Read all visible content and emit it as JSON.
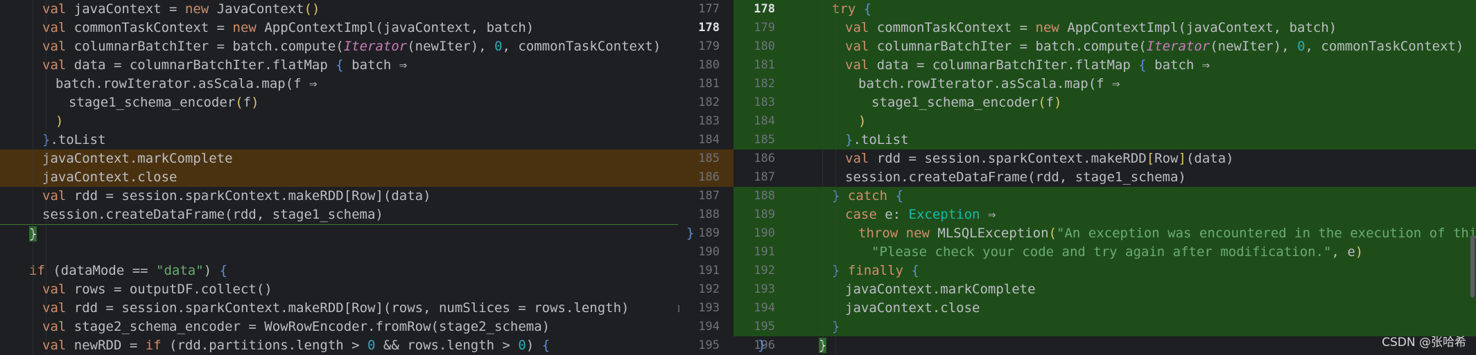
{
  "left": {
    "lines": [
      {
        "indent": 3,
        "tokens": [
          [
            "kw",
            "val"
          ],
          [
            "",
            " javaContext = "
          ],
          [
            "kw",
            "new"
          ],
          [
            "",
            " JavaContext"
          ],
          [
            "br",
            "()"
          ]
        ],
        "bg": ""
      },
      {
        "indent": 3,
        "tokens": [
          [
            "kw",
            "val"
          ],
          [
            "",
            " commonTaskContext = "
          ],
          [
            "kw",
            "new"
          ],
          [
            "",
            " AppContextImpl(javaContext, batch)"
          ]
        ],
        "bg": ""
      },
      {
        "indent": 3,
        "tokens": [
          [
            "kw",
            "val"
          ],
          [
            "",
            " columnarBatchIter = batch.compute("
          ],
          [
            "it",
            "Iterator"
          ],
          [
            "",
            "(newIter), "
          ],
          [
            "numlit",
            "0"
          ],
          [
            "",
            ", commonTaskContext)"
          ]
        ],
        "bg": ""
      },
      {
        "indent": 3,
        "tokens": [
          [
            "kw",
            "val"
          ],
          [
            "",
            " data = columnarBatchIter.flatMap "
          ],
          [
            "brb",
            "{"
          ],
          [
            "",
            " batch ⇒"
          ]
        ],
        "bg": ""
      },
      {
        "indent": 4,
        "tokens": [
          [
            "",
            "batch.rowIterator.asScala.map(f ⇒"
          ]
        ],
        "bg": ""
      },
      {
        "indent": 5,
        "tokens": [
          [
            "",
            "stage1_schema_encoder"
          ],
          [
            "br",
            "("
          ],
          [
            "",
            "f"
          ],
          [
            "br",
            ")"
          ]
        ],
        "bg": ""
      },
      {
        "indent": 4,
        "tokens": [
          [
            "br",
            ")"
          ]
        ],
        "bg": ""
      },
      {
        "indent": 3,
        "tokens": [
          [
            "brb",
            "}"
          ],
          [
            "",
            ".toList"
          ]
        ],
        "bg": ""
      },
      {
        "indent": 3,
        "tokens": [
          [
            "",
            "javaContext.markComplete"
          ]
        ],
        "bg": "mod"
      },
      {
        "indent": 3,
        "tokens": [
          [
            "",
            "javaContext.close"
          ]
        ],
        "bg": "mod"
      },
      {
        "indent": 3,
        "tokens": [
          [
            "kw",
            "val"
          ],
          [
            "",
            " rdd = session.sparkContext.makeRDD[Row](data)"
          ]
        ],
        "bg": ""
      },
      {
        "indent": 3,
        "tokens": [
          [
            "",
            "session.createDataFrame(rdd, stage1_schema)"
          ]
        ],
        "bg": ""
      },
      {
        "indent": 2,
        "tokens": [
          [
            "fold",
            "}"
          ]
        ],
        "bg": "delmark"
      },
      {
        "indent": 0,
        "tokens": [],
        "bg": ""
      },
      {
        "indent": 2,
        "tokens": [
          [
            "kw",
            "if"
          ],
          [
            "",
            " (dataMode == "
          ],
          [
            "str",
            "\"data\""
          ],
          [
            "",
            ") "
          ],
          [
            "brb",
            "{"
          ]
        ],
        "bg": ""
      },
      {
        "indent": 3,
        "tokens": [
          [
            "kw",
            "val"
          ],
          [
            "",
            " rows = outputDF.collect()"
          ]
        ],
        "bg": ""
      },
      {
        "indent": 3,
        "tokens": [
          [
            "kw",
            "val"
          ],
          [
            "",
            " rdd = session.sparkContext.makeRDD[Row](rows, numSlices = rows.length)"
          ]
        ],
        "bg": ""
      },
      {
        "indent": 3,
        "tokens": [
          [
            "kw",
            "val"
          ],
          [
            "",
            " stage2_schema_encoder = WowRowEncoder.fromRow(stage2_schema)"
          ]
        ],
        "bg": ""
      },
      {
        "indent": 3,
        "tokens": [
          [
            "kw",
            "val"
          ],
          [
            "",
            " newRDD = "
          ],
          [
            "kw",
            "if"
          ],
          [
            "",
            " (rdd.partitions.length > "
          ],
          [
            "numlit",
            "0"
          ],
          [
            "",
            " && rows.length > "
          ],
          [
            "numlit",
            "0"
          ],
          [
            "",
            ") "
          ],
          [
            "brb",
            "{"
          ]
        ],
        "bg": ""
      }
    ]
  },
  "gutter": {
    "left_numbers": [
      "177",
      "178",
      "179",
      "180",
      "181",
      "182",
      "183",
      "184",
      "185",
      "186",
      "187",
      "188",
      "189",
      "190",
      "191",
      "192",
      "193",
      "194",
      "195"
    ],
    "right_numbers": [
      "178",
      "179",
      "180",
      "181",
      "182",
      "183",
      "184",
      "185",
      "186",
      "187",
      "188",
      "189",
      "190",
      "191",
      "192",
      "193",
      "194",
      "195",
      "196"
    ],
    "current_left": "178",
    "current_right": "178"
  },
  "right": {
    "lines": [
      {
        "indent": 3,
        "tokens": [
          [
            "kw",
            "try"
          ],
          [
            "",
            " "
          ],
          [
            "brb",
            "{"
          ]
        ],
        "bg": "ins"
      },
      {
        "indent": 4,
        "tokens": [
          [
            "kw",
            "val"
          ],
          [
            "",
            " commonTaskContext = "
          ],
          [
            "kw",
            "new"
          ],
          [
            "",
            " AppContextImpl(javaContext, batch)"
          ]
        ],
        "bg": "ins"
      },
      {
        "indent": 4,
        "tokens": [
          [
            "kw",
            "val"
          ],
          [
            "",
            " columnarBatchIter = batch.compute("
          ],
          [
            "it",
            "Iterator"
          ],
          [
            "",
            "(newIter), "
          ],
          [
            "numlit",
            "0"
          ],
          [
            "",
            ", commonTaskContext)"
          ]
        ],
        "bg": "ins"
      },
      {
        "indent": 4,
        "tokens": [
          [
            "kw",
            "val"
          ],
          [
            "",
            " data = columnarBatchIter.flatMap "
          ],
          [
            "brb",
            "{"
          ],
          [
            "",
            " batch ⇒"
          ]
        ],
        "bg": "ins"
      },
      {
        "indent": 5,
        "tokens": [
          [
            "",
            "batch.rowIterator.asScala.map(f ⇒"
          ]
        ],
        "bg": "ins"
      },
      {
        "indent": 6,
        "tokens": [
          [
            "",
            "stage1_schema_encoder"
          ],
          [
            "br",
            "("
          ],
          [
            "",
            "f"
          ],
          [
            "br",
            ")"
          ]
        ],
        "bg": "ins"
      },
      {
        "indent": 5,
        "tokens": [
          [
            "br",
            ")"
          ]
        ],
        "bg": "ins"
      },
      {
        "indent": 4,
        "tokens": [
          [
            "brb",
            "}"
          ],
          [
            "",
            ".toList"
          ]
        ],
        "bg": "ins"
      },
      {
        "indent": 4,
        "tokens": [
          [
            "kw",
            "val"
          ],
          [
            "",
            " rdd = session.sparkContext.makeRDD"
          ],
          [
            "br",
            "["
          ],
          [
            "",
            "Row"
          ],
          [
            "br",
            "]"
          ],
          [
            "",
            "(data)"
          ]
        ],
        "bg": ""
      },
      {
        "indent": 4,
        "tokens": [
          [
            "",
            "session.createDataFrame(rdd, stage1_schema)"
          ]
        ],
        "bg": ""
      },
      {
        "indent": 3,
        "tokens": [
          [
            "brb",
            "}"
          ],
          [
            "",
            " "
          ],
          [
            "kw",
            "catch"
          ],
          [
            "",
            " "
          ],
          [
            "brb",
            "{"
          ]
        ],
        "bg": "ins"
      },
      {
        "indent": 4,
        "tokens": [
          [
            "kw",
            "case"
          ],
          [
            "",
            " e: "
          ],
          [
            "typ",
            "Exception"
          ],
          [
            "",
            " ⇒"
          ]
        ],
        "bg": "ins"
      },
      {
        "indent": 5,
        "tokens": [
          [
            "kw",
            "throw new"
          ],
          [
            "",
            " MLSQLException"
          ],
          [
            "br",
            "("
          ],
          [
            "str",
            "\"An exception was encountered in the execution of this python task. \" +"
          ]
        ],
        "bg": "ins"
      },
      {
        "indent": 6,
        "tokens": [
          [
            "str",
            "\"Please check your code and try again after modification.\""
          ],
          [
            "",
            ", e"
          ],
          [
            "br",
            ")"
          ]
        ],
        "bg": "ins"
      },
      {
        "indent": 3,
        "tokens": [
          [
            "brb",
            "}"
          ],
          [
            "",
            " "
          ],
          [
            "kw",
            "finally"
          ],
          [
            "",
            " "
          ],
          [
            "brb",
            "{"
          ]
        ],
        "bg": "ins"
      },
      {
        "indent": 4,
        "tokens": [
          [
            "",
            "javaContext.markComplete"
          ]
        ],
        "bg": "ins"
      },
      {
        "indent": 4,
        "tokens": [
          [
            "",
            "javaContext.close"
          ]
        ],
        "bg": "ins"
      },
      {
        "indent": 3,
        "tokens": [
          [
            "brb",
            "}"
          ]
        ],
        "bg": "ins"
      },
      {
        "indent": 2,
        "tokens": [
          [
            "fold",
            "}"
          ]
        ],
        "bg": ""
      }
    ]
  },
  "watermark": "CSDN @张哈希",
  "colors": {
    "background": "#1e1f22",
    "modified": "#4a3211",
    "inserted": "#1f4d1a",
    "keyword": "#cf8e6d",
    "string": "#6aab73",
    "number": "#2aacb8"
  }
}
